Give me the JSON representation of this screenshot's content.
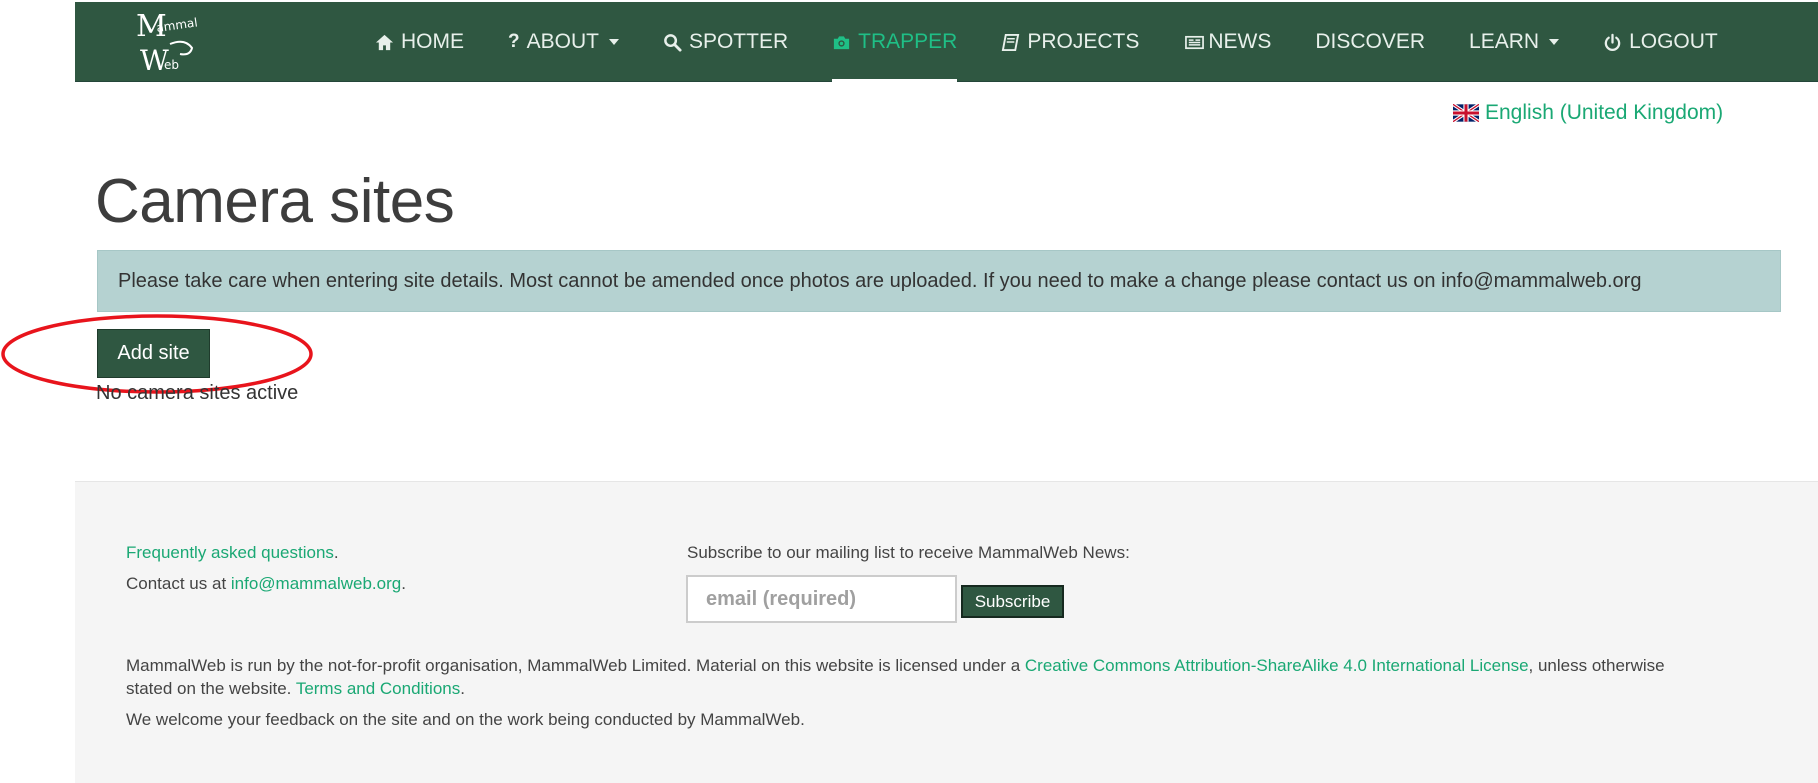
{
  "brand": {
    "logo_text_1": "ammal",
    "logo_text_2": "eb",
    "logo_initial_1": "M",
    "logo_initial_2": "W"
  },
  "nav": {
    "items": [
      {
        "label": "HOME",
        "icon": "home-icon"
      },
      {
        "label": "ABOUT",
        "icon": "question-icon",
        "dropdown": true
      },
      {
        "label": "SPOTTER",
        "icon": "search-icon"
      },
      {
        "label": "TRAPPER",
        "icon": "camera-icon",
        "active": true
      },
      {
        "label": "PROJECTS",
        "icon": "book-icon"
      },
      {
        "label": "NEWS",
        "icon": "newspaper-icon"
      },
      {
        "label": "DISCOVER"
      },
      {
        "label": "LEARN",
        "dropdown": true
      },
      {
        "label": "LOGOUT",
        "icon": "power-icon"
      }
    ]
  },
  "language": {
    "label": "English (United Kingdom)",
    "icon": "uk-flag-icon"
  },
  "main": {
    "title": "Camera sites",
    "alert": "Please take care when entering site details. Most cannot be amended once photos are uploaded. If you need to make a change please contact us on info@mammalweb.org",
    "add_site_label": "Add site",
    "empty_message": "No camera sites active"
  },
  "footer": {
    "faq_link": "Frequently asked questions",
    "faq_suffix": ".",
    "contact_prefix": "Contact us at ",
    "contact_email": "info@mammalweb.org",
    "contact_suffix": ".",
    "subscribe_heading": "Subscribe to our mailing list to receive MammalWeb News:",
    "email_placeholder": "email (required)",
    "subscribe_label": "Subscribe",
    "legal_prefix": "MammalWeb is run by the not-for-profit organisation, MammalWeb Limited. Material on this website is licensed under a ",
    "license_link": "Creative Commons Attribution-ShareAlike 4.0 International License",
    "legal_suffix": ", unless otherwise",
    "legal_line2_prefix": "stated on the website. ",
    "terms_link": "Terms and Conditions",
    "terms_suffix": ".",
    "feedback": "We welcome your feedback on the site and on the work being conducted by MammalWeb."
  },
  "colors": {
    "nav_bg": "#2f5741",
    "accent": "#1aa874",
    "alert_bg": "#b5d2d1",
    "highlight": "#e8141c"
  }
}
